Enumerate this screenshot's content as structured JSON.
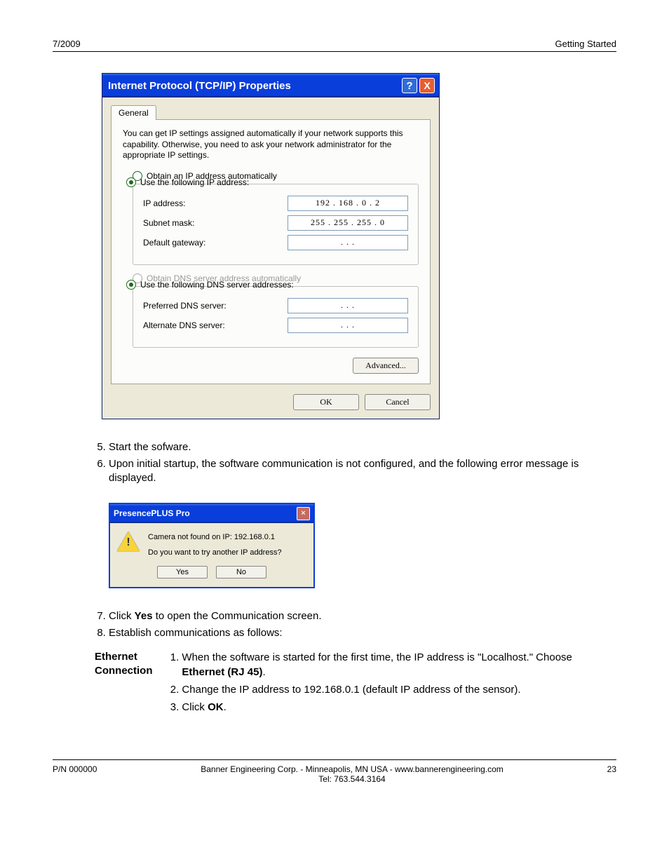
{
  "header": {
    "left": "7/2009",
    "right": "Getting Started"
  },
  "dialog1": {
    "title": "Internet Protocol (TCP/IP) Properties",
    "help": "?",
    "close": "X",
    "tab": "General",
    "intro": "You can get IP settings assigned automatically if your network supports this capability. Otherwise, you need to ask your network administrator for the appropriate IP settings.",
    "radio_auto_ip": "Obtain an IP address automatically",
    "radio_use_ip": "Use the following IP address:",
    "ip_label": "IP address:",
    "ip_value": "192 . 168 .   0   .   2",
    "subnet_label": "Subnet mask:",
    "subnet_value": "255 . 255 . 255 .   0",
    "gateway_label": "Default gateway:",
    "gateway_value": ".         .         .",
    "radio_auto_dns": "Obtain DNS server address automatically",
    "radio_use_dns": "Use the following DNS server addresses:",
    "pref_dns_label": "Preferred DNS server:",
    "pref_dns_value": ".         .         .",
    "alt_dns_label": "Alternate DNS server:",
    "alt_dns_value": ".         .         .",
    "advanced": "Advanced...",
    "ok": "OK",
    "cancel": "Cancel"
  },
  "steps_a": {
    "item5": "Start the sofware.",
    "item6": "Upon initial startup, the software communication is not configured, and the following error message is displayed."
  },
  "dialog2": {
    "title": "PresencePLUS Pro",
    "line1": "Camera not found on IP: 192.168.0.1",
    "line2": "Do you want to try another IP address?",
    "yes": "Yes",
    "no": "No"
  },
  "steps_b": {
    "item7_pre": "Click ",
    "item7_bold": "Yes",
    "item7_post": " to open the Communication screen.",
    "item8": "Establish communications as follows:"
  },
  "eth": {
    "heading": "Ethernet Connection",
    "s1a": "When the software is started for the first time, the IP address is \"Localhost.\" Choose ",
    "s1b": "Ethernet (RJ 45)",
    "s1c": ".",
    "s2": "Change the IP address to 192.168.0.1 (default IP address of the sensor).",
    "s3a": "Click ",
    "s3b": "OK",
    "s3c": "."
  },
  "footer": {
    "left": "P/N 000000",
    "center1": "Banner Engineering Corp. - Minneapolis, MN USA - www.bannerengineering.com",
    "center2": "Tel: 763.544.3164",
    "right": "23"
  }
}
